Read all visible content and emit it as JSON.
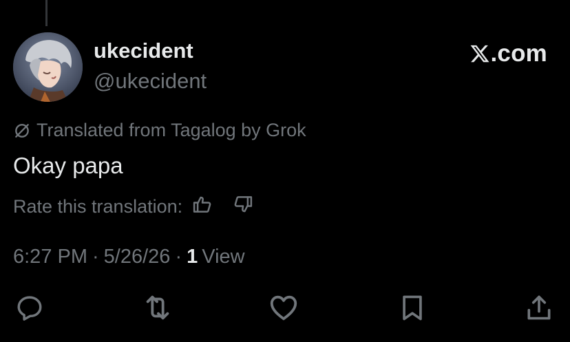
{
  "post": {
    "display_name": "ukecident",
    "handle": "@ukecident",
    "avatar_icon": "anime-character-avatar",
    "brand": {
      "logo_icon": "x-logo-icon",
      "text": ".com"
    },
    "translation_notice": "Translated from Tagalog by Grok",
    "text": "Okay papa",
    "rate_label": "Rate this translation:",
    "time": "6:27 PM",
    "separator": "·",
    "date": "5/26/26",
    "views_count": "1",
    "views_label": "View"
  },
  "actions": [
    {
      "name": "reply",
      "icon": "reply-icon"
    },
    {
      "name": "repost",
      "icon": "repost-icon"
    },
    {
      "name": "like",
      "icon": "heart-icon"
    },
    {
      "name": "bookmark",
      "icon": "bookmark-icon"
    },
    {
      "name": "share",
      "icon": "share-icon"
    }
  ],
  "colors": {
    "background": "#000000",
    "primary_text": "#e7e9ea",
    "secondary_text": "#71767b",
    "thread_line": "#333639"
  }
}
